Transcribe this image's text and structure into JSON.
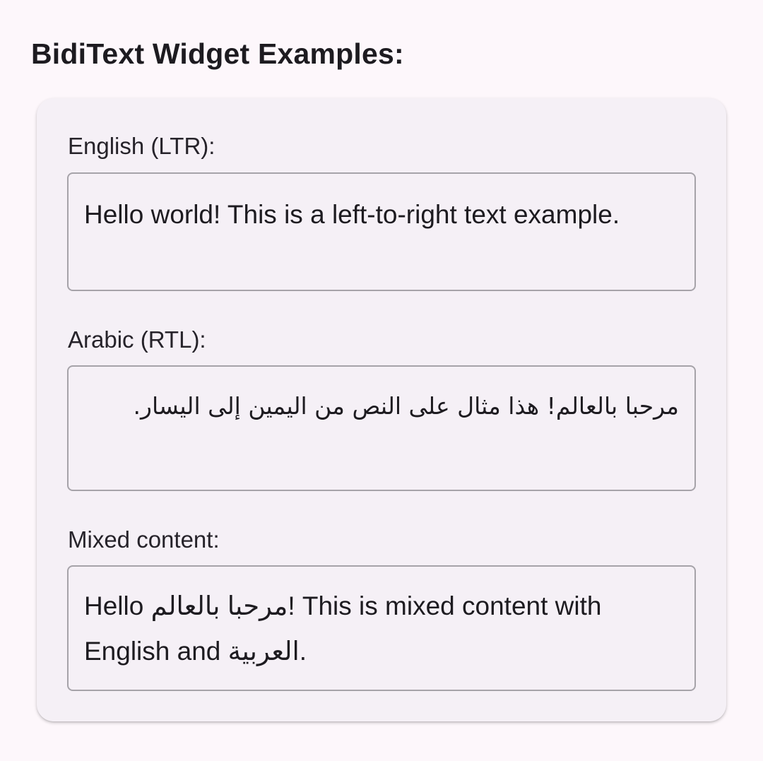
{
  "page": {
    "title": "BidiText Widget Examples:"
  },
  "examples": {
    "english": {
      "label": "English (LTR):",
      "text": "Hello world! This is a left-to-right text example."
    },
    "arabic": {
      "label": "Arabic (RTL):",
      "text": "مرحبا بالعالم! هذا مثال على النص من اليمين إلى اليسار."
    },
    "mixed": {
      "label": "Mixed content:",
      "text": "Hello مرحبا بالعالم! This is mixed content with English and العربية."
    }
  },
  "colors": {
    "background": "#fdf7fb",
    "card": "#f5f0f6",
    "border": "#a6a3a9",
    "text": "#1d1b20"
  }
}
